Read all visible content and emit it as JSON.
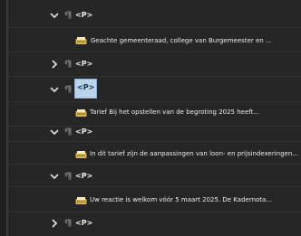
{
  "tree": {
    "node_tag": "<P>",
    "items": [
      {
        "kind": "tag",
        "expanded": true,
        "selected": false,
        "tag": "<P>"
      },
      {
        "kind": "content",
        "text": "Geachte gemeenteraad, college van Burgemeester en ..."
      },
      {
        "kind": "tag",
        "expanded": false,
        "selected": false,
        "tag": "<P>"
      },
      {
        "kind": "tag",
        "expanded": true,
        "selected": true,
        "tag": "<P>"
      },
      {
        "kind": "content",
        "text": "Tarief Bij het opstellen van de begroting 2025 heeft..."
      },
      {
        "kind": "tag",
        "expanded": true,
        "selected": false,
        "tag": "<P>"
      },
      {
        "kind": "content",
        "text": "In dit tarief zijn de aanpassingen van loon- en prijsindexeringen..."
      },
      {
        "kind": "tag",
        "expanded": true,
        "selected": false,
        "tag": "<P>"
      },
      {
        "kind": "content",
        "text": "Uw reactie is welkom vóór 5 maart 2025. De Kadernota..."
      },
      {
        "kind": "tag",
        "expanded": false,
        "selected": false,
        "tag": "<P>"
      }
    ]
  },
  "colors": {
    "background": "#262626",
    "selection": "#b9d3ea",
    "text": "#ececec",
    "icon_gold": "#d9b24a"
  }
}
